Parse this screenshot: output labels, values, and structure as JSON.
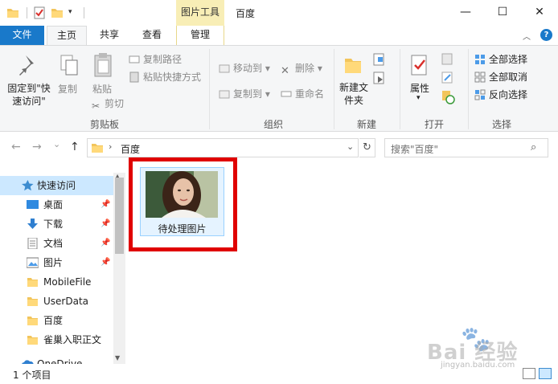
{
  "window": {
    "title": "百度",
    "context_tab_group": "图片工具",
    "controls": {
      "minimize": "—",
      "maximize": "☐",
      "close": "✕"
    }
  },
  "quick_access_toolbar": {
    "dropdown": "▾"
  },
  "ribbon_tabs": {
    "file": "文件",
    "home": "主页",
    "share": "共享",
    "view": "查看",
    "manage": "管理",
    "minimize": "︿",
    "help": "?"
  },
  "ribbon": {
    "clipboard": {
      "pin_quick_access": "固定到\"快速访问\"",
      "copy": "复制",
      "paste": "粘贴",
      "copy_path": "复制路径",
      "paste_shortcut": "粘贴快捷方式",
      "cut": "剪切",
      "group_label": "剪贴板"
    },
    "organize": {
      "move_to": "移动到",
      "copy_to": "复制到",
      "delete": "删除",
      "rename": "重命名",
      "group_label": "组织"
    },
    "new": {
      "new_folder": "新建文件夹",
      "group_label": "新建"
    },
    "open": {
      "properties": "属性",
      "group_label": "打开"
    },
    "select": {
      "select_all": "全部选择",
      "select_none": "全部取消",
      "invert_selection": "反向选择",
      "group_label": "选择"
    }
  },
  "navigation": {
    "back": "←",
    "forward": "→",
    "recent": "⌄",
    "up": "↑",
    "path_chevron": "›",
    "path_current": "百度",
    "address_dropdown": "⌄",
    "refresh": "↻",
    "search_placeholder": "搜索\"百度\"",
    "search_glyph": "⌕"
  },
  "nav_pane": {
    "pin_glyph": "📌",
    "items": [
      {
        "label": "快速访问",
        "icon": "star-icon",
        "selected": true,
        "pinned": false
      },
      {
        "label": "桌面",
        "icon": "desktop-icon",
        "pinned": true
      },
      {
        "label": "下载",
        "icon": "download-icon",
        "pinned": true
      },
      {
        "label": "文档",
        "icon": "document-icon",
        "pinned": true
      },
      {
        "label": "图片",
        "icon": "pictures-icon",
        "pinned": true
      },
      {
        "label": "MobileFile",
        "icon": "folder-icon"
      },
      {
        "label": "UserData",
        "icon": "folder-icon"
      },
      {
        "label": "百度",
        "icon": "folder-icon"
      },
      {
        "label": "雀巢入职正文",
        "icon": "folder-icon"
      },
      {
        "label": "OneDrive",
        "icon": "cloud-icon"
      }
    ]
  },
  "content": {
    "files": [
      {
        "name": "待处理图片",
        "type": "image"
      }
    ]
  },
  "status_bar": {
    "item_count": "1 个项目"
  },
  "watermark": {
    "main": "Bai 经验",
    "sub": "jingyan.baidu.com"
  },
  "colors": {
    "accent": "#1979ca",
    "context_tab": "#f8eeb6",
    "selection": "#cce8ff",
    "highlight_border": "#e00000"
  }
}
